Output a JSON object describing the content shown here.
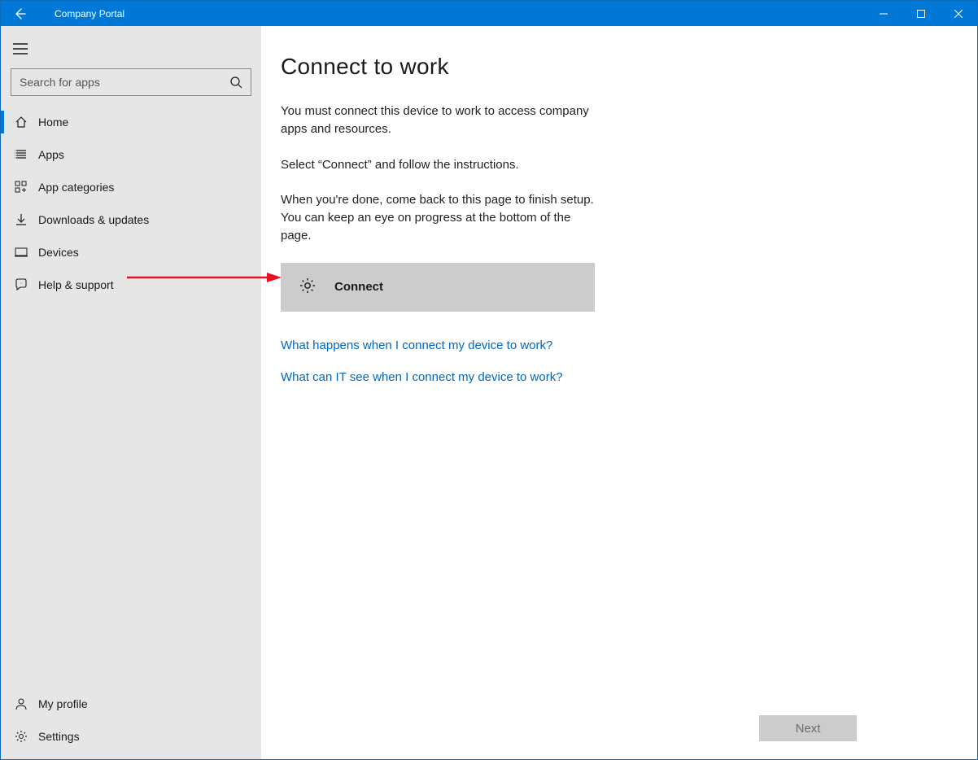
{
  "titlebar": {
    "title": "Company Portal"
  },
  "search": {
    "placeholder": "Search for apps"
  },
  "sidebar": {
    "items": [
      {
        "label": "Home"
      },
      {
        "label": "Apps"
      },
      {
        "label": "App categories"
      },
      {
        "label": "Downloads & updates"
      },
      {
        "label": "Devices"
      },
      {
        "label": "Help & support"
      }
    ],
    "bottom": [
      {
        "label": "My profile"
      },
      {
        "label": "Settings"
      }
    ]
  },
  "main": {
    "title": "Connect to work",
    "para1": "You must connect this device to work to access company apps and resources.",
    "para2": "Select “Connect” and follow the instructions.",
    "para3": "When you're done, come back to this page to finish setup. You can keep an eye on progress at the bottom of the page.",
    "connect_label": "Connect",
    "link1": "What happens when I connect my device to work?",
    "link2": "What can IT see when I connect my device to work?",
    "next_label": "Next"
  }
}
